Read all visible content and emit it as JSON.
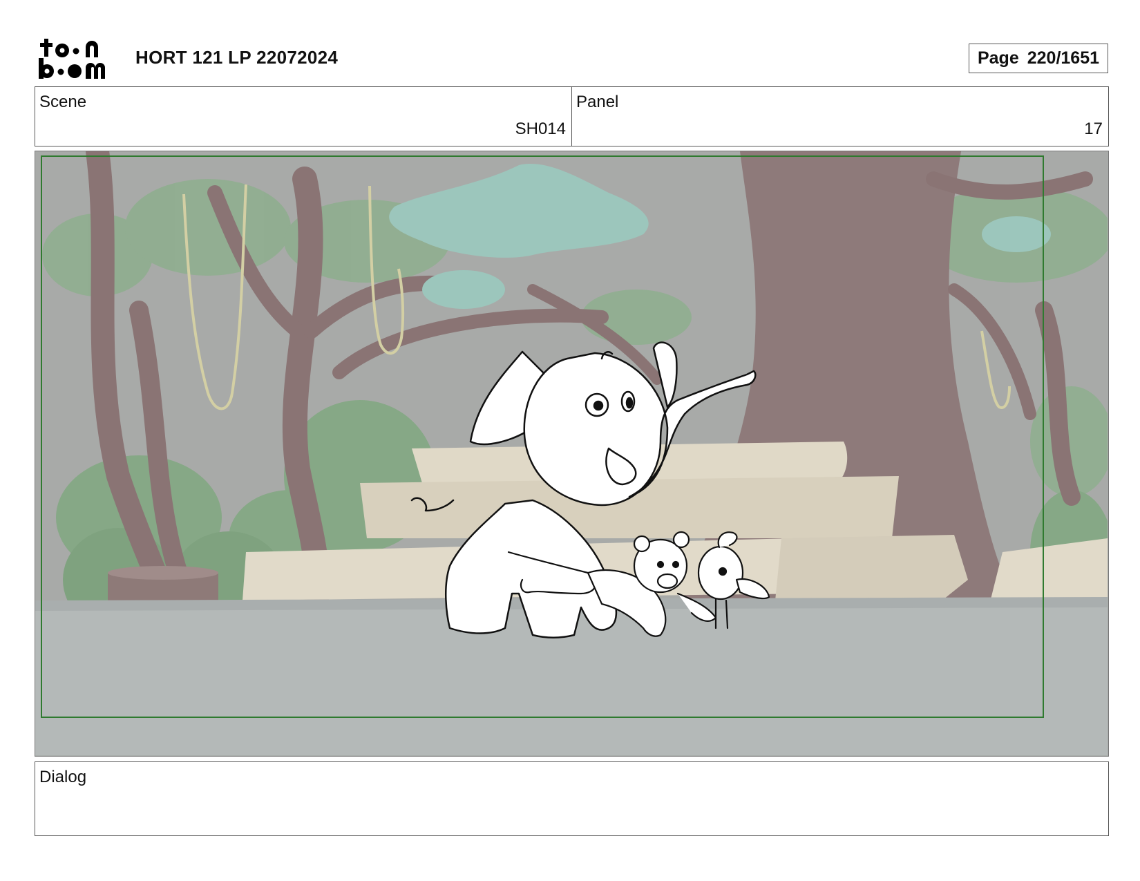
{
  "header": {
    "logo_text": "toon boom",
    "document_title": "HORT 121 LP 22072024",
    "page_label": "Page",
    "page_number": "220/1651"
  },
  "scene": {
    "label": "Scene",
    "value": "SH014"
  },
  "panel": {
    "label": "Panel",
    "value": "17"
  },
  "dialog": {
    "label": "Dialog",
    "text": ""
  },
  "colors": {
    "border": "#555555",
    "safe_frame": "#2f7a2f",
    "ground": "#b4b9b8",
    "tree_trunk": "#8a7676",
    "foliage": "#7fa07f",
    "canopy": "#9ec9c0",
    "rock": "#ddd6c6"
  },
  "icons": [
    "toon-boom-logo"
  ]
}
